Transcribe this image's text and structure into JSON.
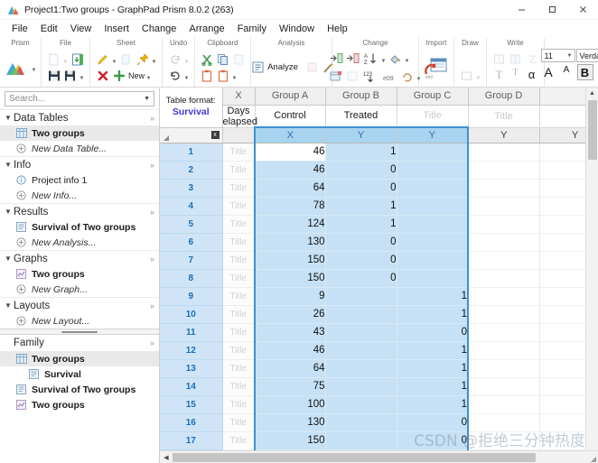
{
  "window": {
    "title": "Project1:Two groups - GraphPad Prism 8.0.2 (263)",
    "app_icon": "prism-logo-icon",
    "minimize_label": "–",
    "maximize_label": "☐",
    "close_label": "✕"
  },
  "menubar": {
    "items": [
      {
        "label": "File"
      },
      {
        "label": "Edit"
      },
      {
        "label": "View"
      },
      {
        "label": "Insert"
      },
      {
        "label": "Change"
      },
      {
        "label": "Arrange"
      },
      {
        "label": "Family"
      },
      {
        "label": "Window"
      },
      {
        "label": "Help"
      }
    ]
  },
  "ribbon": {
    "groups": [
      {
        "label": "Prism"
      },
      {
        "label": "File"
      },
      {
        "label": "Sheet"
      },
      {
        "label": "Undo"
      },
      {
        "label": "Clipboard"
      },
      {
        "label": "Analysis"
      },
      {
        "label": "Change"
      },
      {
        "label": "Import"
      },
      {
        "label": "Draw"
      },
      {
        "label": "Write"
      }
    ],
    "new_sheet_label": "New",
    "analyze_label": "Analyze",
    "font_size": "11",
    "font_name": "Verdana",
    "bold_label": "B"
  },
  "navigator": {
    "search": {
      "placeholder": "Search...",
      "value": ""
    },
    "sections": [
      {
        "title": "Data Tables",
        "more": "»",
        "items": [
          {
            "label": "Two groups",
            "icon": "data-table-icon",
            "style": "bold",
            "selected": true
          },
          {
            "label": "New Data Table...",
            "icon": "plus-circle-icon",
            "style": "italic",
            "selected": false
          }
        ]
      },
      {
        "title": "Info",
        "more": "»",
        "items": [
          {
            "label": "Project info 1",
            "icon": "info-circle-icon",
            "style": "normal",
            "selected": false
          },
          {
            "label": "New Info...",
            "icon": "plus-circle-icon",
            "style": "italic",
            "selected": false
          }
        ]
      },
      {
        "title": "Results",
        "more": "»",
        "items": [
          {
            "label": "Survival of Two groups",
            "icon": "results-sheet-icon",
            "style": "bold",
            "selected": false
          },
          {
            "label": "New Analysis...",
            "icon": "plus-circle-icon",
            "style": "italic",
            "selected": false
          }
        ]
      },
      {
        "title": "Graphs",
        "more": "»",
        "items": [
          {
            "label": "Two groups",
            "icon": "graph-icon",
            "style": "bold",
            "selected": false
          },
          {
            "label": "New Graph...",
            "icon": "plus-circle-icon",
            "style": "italic",
            "selected": false
          }
        ]
      },
      {
        "title": "Layouts",
        "more": "»",
        "items": [
          {
            "label": "New Layout...",
            "icon": "plus-circle-icon",
            "style": "italic",
            "selected": false
          }
        ]
      }
    ],
    "family": {
      "title": "Family",
      "more": "»",
      "items": [
        {
          "label": "Two groups",
          "icon": "data-table-icon",
          "style": "bold",
          "indent": 1,
          "selected": true
        },
        {
          "label": "Survival",
          "icon": "results-sheet-icon",
          "style": "bold",
          "indent": 2,
          "selected": false
        },
        {
          "label": "Survival of Two groups",
          "icon": "results-sheet-icon",
          "style": "bold",
          "indent": 1,
          "selected": false
        },
        {
          "label": "Two groups",
          "icon": "graph-icon",
          "style": "bold",
          "indent": 1,
          "selected": false
        }
      ]
    }
  },
  "sheet": {
    "table_format_label": "Table format:",
    "table_format_value": "Survival",
    "close_column_label": "x",
    "group_headers": [
      "X",
      "Group A",
      "Group B",
      "Group C",
      "Group D"
    ],
    "column_titles": [
      "Days elapsed",
      "Control",
      "Treated",
      "Title",
      "Title"
    ],
    "column_title_placeholder": "Title",
    "subheaders": [
      "X",
      "Y",
      "Y",
      "Y",
      "Y"
    ],
    "row_title_placeholder": "Title",
    "selected_columns": [
      0,
      1,
      2
    ],
    "rows": [
      {
        "num": "1",
        "title": "Title",
        "x": "46",
        "a": "1",
        "b": "",
        "c": "",
        "d": ""
      },
      {
        "num": "2",
        "title": "Title",
        "x": "46",
        "a": "0",
        "b": "",
        "c": "",
        "d": ""
      },
      {
        "num": "3",
        "title": "Title",
        "x": "64",
        "a": "0",
        "b": "",
        "c": "",
        "d": ""
      },
      {
        "num": "4",
        "title": "Title",
        "x": "78",
        "a": "1",
        "b": "",
        "c": "",
        "d": ""
      },
      {
        "num": "5",
        "title": "Title",
        "x": "124",
        "a": "1",
        "b": "",
        "c": "",
        "d": ""
      },
      {
        "num": "6",
        "title": "Title",
        "x": "130",
        "a": "0",
        "b": "",
        "c": "",
        "d": ""
      },
      {
        "num": "7",
        "title": "Title",
        "x": "150",
        "a": "0",
        "b": "",
        "c": "",
        "d": ""
      },
      {
        "num": "8",
        "title": "Title",
        "x": "150",
        "a": "0",
        "b": "",
        "c": "",
        "d": ""
      },
      {
        "num": "9",
        "title": "Title",
        "x": "9",
        "a": "",
        "b": "1",
        "c": "",
        "d": ""
      },
      {
        "num": "10",
        "title": "Title",
        "x": "26",
        "a": "",
        "b": "1",
        "c": "",
        "d": ""
      },
      {
        "num": "11",
        "title": "Title",
        "x": "43",
        "a": "",
        "b": "0",
        "c": "",
        "d": ""
      },
      {
        "num": "12",
        "title": "Title",
        "x": "46",
        "a": "",
        "b": "1",
        "c": "",
        "d": ""
      },
      {
        "num": "13",
        "title": "Title",
        "x": "64",
        "a": "",
        "b": "1",
        "c": "",
        "d": ""
      },
      {
        "num": "14",
        "title": "Title",
        "x": "75",
        "a": "",
        "b": "1",
        "c": "",
        "d": ""
      },
      {
        "num": "15",
        "title": "Title",
        "x": "100",
        "a": "",
        "b": "1",
        "c": "",
        "d": ""
      },
      {
        "num": "16",
        "title": "Title",
        "x": "130",
        "a": "",
        "b": "0",
        "c": "",
        "d": ""
      },
      {
        "num": "17",
        "title": "Title",
        "x": "150",
        "a": "",
        "b": "0",
        "c": "",
        "d": ""
      }
    ]
  },
  "watermark": {
    "text": "CSDN @拒绝三分钟热度"
  }
}
